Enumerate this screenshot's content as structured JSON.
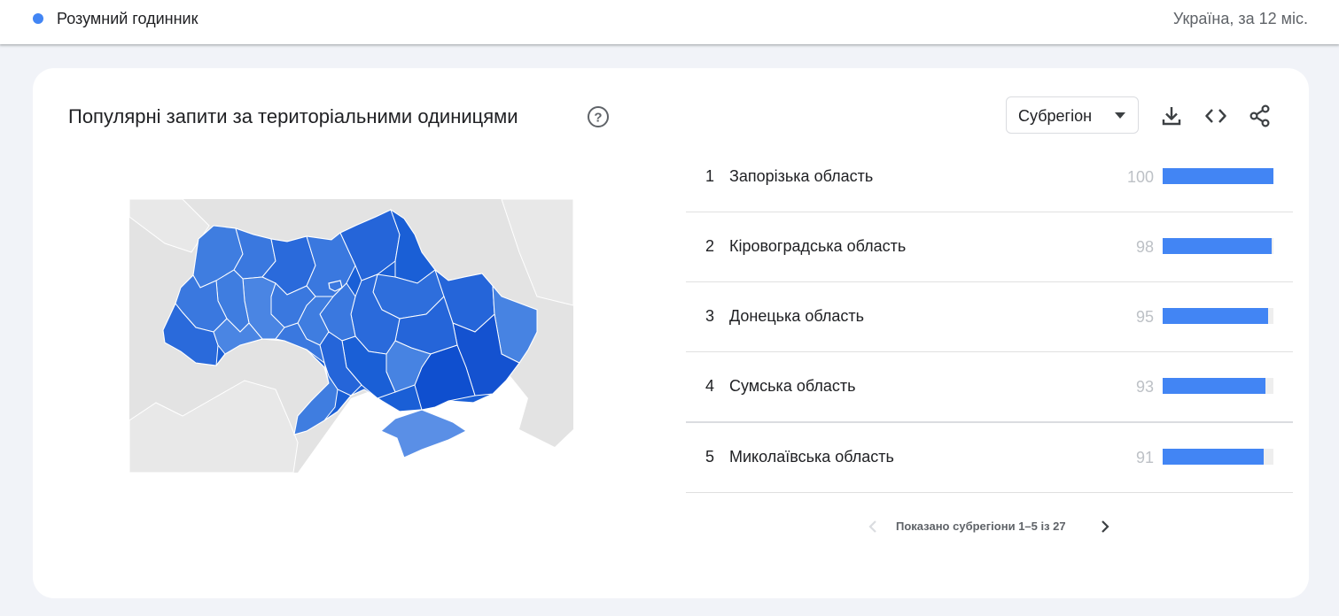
{
  "header": {
    "term": "Розумний годинник",
    "term_color": "#4285f4",
    "scope": "Україна, за 12 міс."
  },
  "card": {
    "title": "Популярні запити за територіальними одиницями",
    "help_icon": "help-circle-icon",
    "resolution_select": "Субрегіон",
    "toolbar": [
      "download-icon",
      "embed-code-icon",
      "share-icon"
    ]
  },
  "map": {
    "country": "Україна",
    "fill_color": "#1a5fd6"
  },
  "ranking": [
    {
      "rank": "1",
      "region": "Запорізька область",
      "value": 100
    },
    {
      "rank": "2",
      "region": "Кіровоградська область",
      "value": 98
    },
    {
      "rank": "3",
      "region": "Донецька область",
      "value": 95
    },
    {
      "rank": "4",
      "region": "Сумська область",
      "value": 93
    },
    {
      "rank": "5",
      "region": "Миколаївська область",
      "value": 91
    }
  ],
  "pagination": {
    "text": "Показано субрегіони 1–5 із 27"
  }
}
